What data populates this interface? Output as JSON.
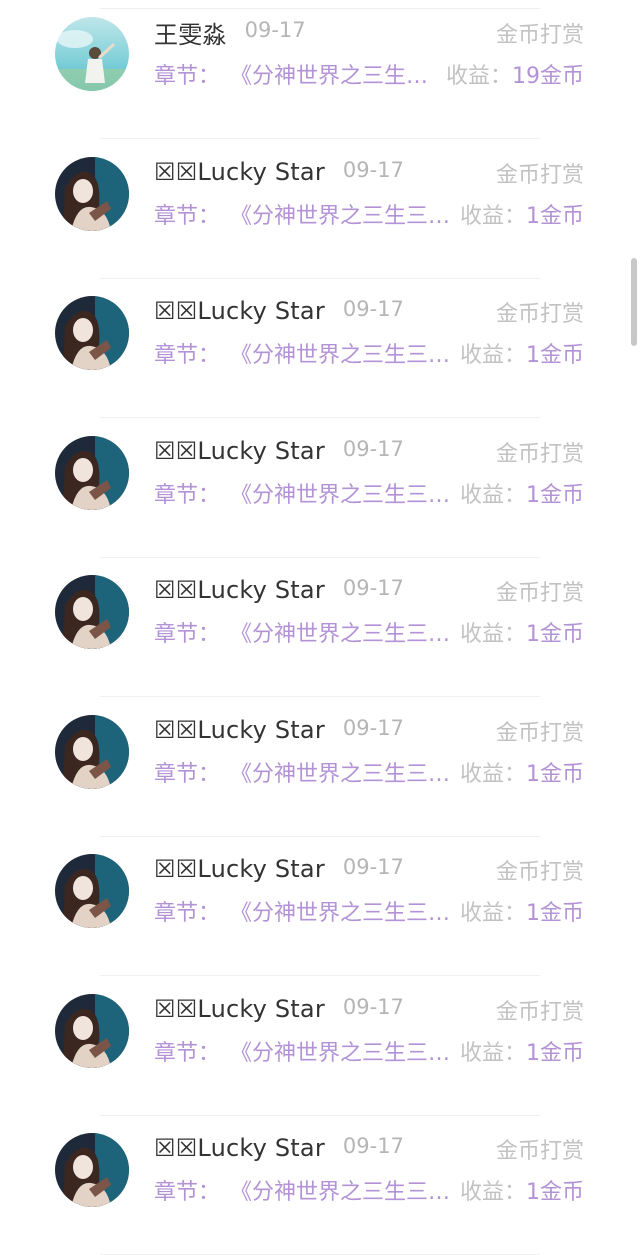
{
  "tips": [
    {
      "user": "王雯淼",
      "date": "09-17",
      "type": "金币打赏",
      "chapter_label": "章节：",
      "chapter": "《分神世界之三生三世》",
      "income_label": "收益：",
      "income": "19金币",
      "avatar": "girl-beach"
    },
    {
      "user": "☒☒Lucky Star",
      "date": "09-17",
      "type": "金币打赏",
      "chapter_label": "章节：",
      "chapter": "《分神世界之三生三世》",
      "income_label": "收益：",
      "income": "1金币",
      "avatar": "girl-dark"
    },
    {
      "user": "☒☒Lucky Star",
      "date": "09-17",
      "type": "金币打赏",
      "chapter_label": "章节：",
      "chapter": "《分神世界之三生三世》",
      "income_label": "收益：",
      "income": "1金币",
      "avatar": "girl-dark"
    },
    {
      "user": "☒☒Lucky Star",
      "date": "09-17",
      "type": "金币打赏",
      "chapter_label": "章节：",
      "chapter": "《分神世界之三生三世》",
      "income_label": "收益：",
      "income": "1金币",
      "avatar": "girl-dark"
    },
    {
      "user": "☒☒Lucky Star",
      "date": "09-17",
      "type": "金币打赏",
      "chapter_label": "章节：",
      "chapter": "《分神世界之三生三世》",
      "income_label": "收益：",
      "income": "1金币",
      "avatar": "girl-dark"
    },
    {
      "user": "☒☒Lucky Star",
      "date": "09-17",
      "type": "金币打赏",
      "chapter_label": "章节：",
      "chapter": "《分神世界之三生三世》",
      "income_label": "收益：",
      "income": "1金币",
      "avatar": "girl-dark"
    },
    {
      "user": "☒☒Lucky Star",
      "date": "09-17",
      "type": "金币打赏",
      "chapter_label": "章节：",
      "chapter": "《分神世界之三生三世》",
      "income_label": "收益：",
      "income": "1金币",
      "avatar": "girl-dark"
    },
    {
      "user": "☒☒Lucky Star",
      "date": "09-17",
      "type": "金币打赏",
      "chapter_label": "章节：",
      "chapter": "《分神世界之三生三世》",
      "income_label": "收益：",
      "income": "1金币",
      "avatar": "girl-dark"
    },
    {
      "user": "☒☒Lucky Star",
      "date": "09-17",
      "type": "金币打赏",
      "chapter_label": "章节：",
      "chapter": "《分神世界之三生三世》",
      "income_label": "收益：",
      "income": "1金币",
      "avatar": "girl-dark"
    }
  ],
  "colors": {
    "accent": "#b393d6",
    "muted": "#c2c2c2",
    "name": "#333333"
  }
}
